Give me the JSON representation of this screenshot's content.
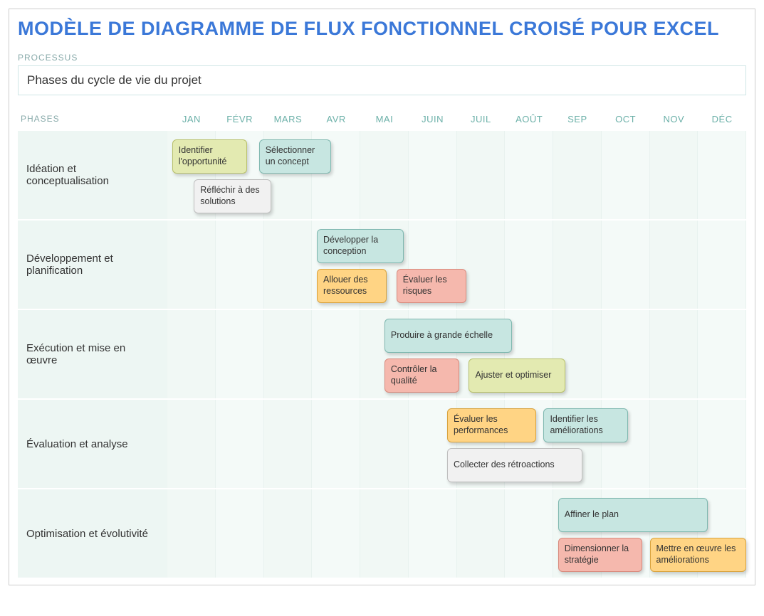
{
  "title": "MODÈLE DE DIAGRAMME DE FLUX FONCTIONNEL CROISÉ POUR EXCEL",
  "processus_label": "PROCESSUS",
  "processus_value": "Phases du cycle de vie du projet",
  "phases_label": "PHASES",
  "months": [
    "JAN",
    "FÉVR",
    "MARS",
    "AVR",
    "MAI",
    "JUIN",
    "JUIL",
    "AOÛT",
    "SEP",
    "OCT",
    "NOV",
    "DÉC"
  ],
  "lanes": [
    {
      "name": "Idéation et conceptualisation",
      "height": 126,
      "tasks": [
        {
          "label": "Identifier l'opportunité",
          "start": 0.1,
          "span": 1.55,
          "row": 0,
          "color": "yellow"
        },
        {
          "label": "Sélectionner un concept",
          "start": 1.9,
          "span": 1.5,
          "row": 0,
          "color": "teal"
        },
        {
          "label": "Réfléchir à des solutions",
          "start": 0.55,
          "span": 1.6,
          "row": 1,
          "color": "grey"
        }
      ]
    },
    {
      "name": "Développement et planification",
      "height": 126,
      "tasks": [
        {
          "label": "Développer la conception",
          "start": 3.1,
          "span": 1.8,
          "row": 0,
          "color": "teal"
        },
        {
          "label": "Allouer des ressources",
          "start": 3.1,
          "span": 1.45,
          "row": 1,
          "color": "orange"
        },
        {
          "label": "Évaluer les risques",
          "start": 4.75,
          "span": 1.45,
          "row": 1,
          "color": "salmon"
        }
      ]
    },
    {
      "name": "Exécution et mise en œuvre",
      "height": 126,
      "tasks": [
        {
          "label": "Produire à grande échelle",
          "start": 4.5,
          "span": 2.65,
          "row": 0,
          "color": "teal"
        },
        {
          "label": "Contrôler la qualité",
          "start": 4.5,
          "span": 1.55,
          "row": 1,
          "color": "salmon"
        },
        {
          "label": "Ajuster et optimiser",
          "start": 6.25,
          "span": 2.0,
          "row": 1,
          "color": "yellow"
        }
      ]
    },
    {
      "name": "Évaluation et analyse",
      "height": 126,
      "tasks": [
        {
          "label": "Évaluer les performances",
          "start": 5.8,
          "span": 1.85,
          "row": 0,
          "color": "orange"
        },
        {
          "label": "Identifier les améliorations",
          "start": 7.8,
          "span": 1.75,
          "row": 0,
          "color": "teal"
        },
        {
          "label": "Collecter des rétroactions",
          "start": 5.8,
          "span": 2.8,
          "row": 1,
          "color": "grey"
        }
      ]
    },
    {
      "name": "Optimisation et évolutivité",
      "height": 126,
      "tasks": [
        {
          "label": "Affiner le plan",
          "start": 8.1,
          "span": 3.1,
          "row": 0,
          "color": "teal"
        },
        {
          "label": "Dimensionner la stratégie",
          "start": 8.1,
          "span": 1.75,
          "row": 1,
          "color": "salmon"
        },
        {
          "label": "Mettre en œuvre les améliorations",
          "start": 10.0,
          "span": 2.0,
          "row": 1,
          "color": "orange"
        }
      ]
    }
  ],
  "chart_data": {
    "type": "gantt-swimlane",
    "title": "Phases du cycle de vie du projet",
    "x_categories": [
      "JAN",
      "FÉVR",
      "MARS",
      "AVR",
      "MAI",
      "JUIN",
      "JUIL",
      "AOÛT",
      "SEP",
      "OCT",
      "NOV",
      "DÉC"
    ],
    "swimlanes": [
      "Idéation et conceptualisation",
      "Développement et planification",
      "Exécution et mise en œuvre",
      "Évaluation et analyse",
      "Optimisation et évolutivité"
    ],
    "tasks": [
      {
        "lane": "Idéation et conceptualisation",
        "label": "Identifier l'opportunité",
        "start_month": "JAN",
        "end_month": "FÉVR",
        "color": "yellow-green"
      },
      {
        "lane": "Idéation et conceptualisation",
        "label": "Sélectionner un concept",
        "start_month": "MARS",
        "end_month": "AVR",
        "color": "teal"
      },
      {
        "lane": "Idéation et conceptualisation",
        "label": "Réfléchir à des solutions",
        "start_month": "JAN",
        "end_month": "MARS",
        "color": "grey"
      },
      {
        "lane": "Développement et planification",
        "label": "Développer la conception",
        "start_month": "AVR",
        "end_month": "MAI",
        "color": "teal"
      },
      {
        "lane": "Développement et planification",
        "label": "Allouer des ressources",
        "start_month": "AVR",
        "end_month": "MAI",
        "color": "orange"
      },
      {
        "lane": "Développement et planification",
        "label": "Évaluer les risques",
        "start_month": "MAI",
        "end_month": "JUIN",
        "color": "salmon"
      },
      {
        "lane": "Exécution et mise en œuvre",
        "label": "Produire à grande échelle",
        "start_month": "MAI",
        "end_month": "AOÛT",
        "color": "teal"
      },
      {
        "lane": "Exécution et mise en œuvre",
        "label": "Contrôler la qualité",
        "start_month": "MAI",
        "end_month": "JUIN",
        "color": "salmon"
      },
      {
        "lane": "Exécution et mise en œuvre",
        "label": "Ajuster et optimiser",
        "start_month": "JUIL",
        "end_month": "AOÛT",
        "color": "yellow-green"
      },
      {
        "lane": "Évaluation et analyse",
        "label": "Évaluer les performances",
        "start_month": "JUIN",
        "end_month": "AOÛT",
        "color": "orange"
      },
      {
        "lane": "Évaluation et analyse",
        "label": "Identifier les améliorations",
        "start_month": "AOÛT",
        "end_month": "OCT",
        "color": "teal"
      },
      {
        "lane": "Évaluation et analyse",
        "label": "Collecter des rétroactions",
        "start_month": "JUIN",
        "end_month": "SEP",
        "color": "grey"
      },
      {
        "lane": "Optimisation et évolutivité",
        "label": "Affiner le plan",
        "start_month": "SEP",
        "end_month": "NOV",
        "color": "teal"
      },
      {
        "lane": "Optimisation et évolutivité",
        "label": "Dimensionner la stratégie",
        "start_month": "SEP",
        "end_month": "OCT",
        "color": "salmon"
      },
      {
        "lane": "Optimisation et évolutivité",
        "label": "Mettre en œuvre les améliorations",
        "start_month": "NOV",
        "end_month": "DÉC",
        "color": "orange"
      }
    ]
  }
}
